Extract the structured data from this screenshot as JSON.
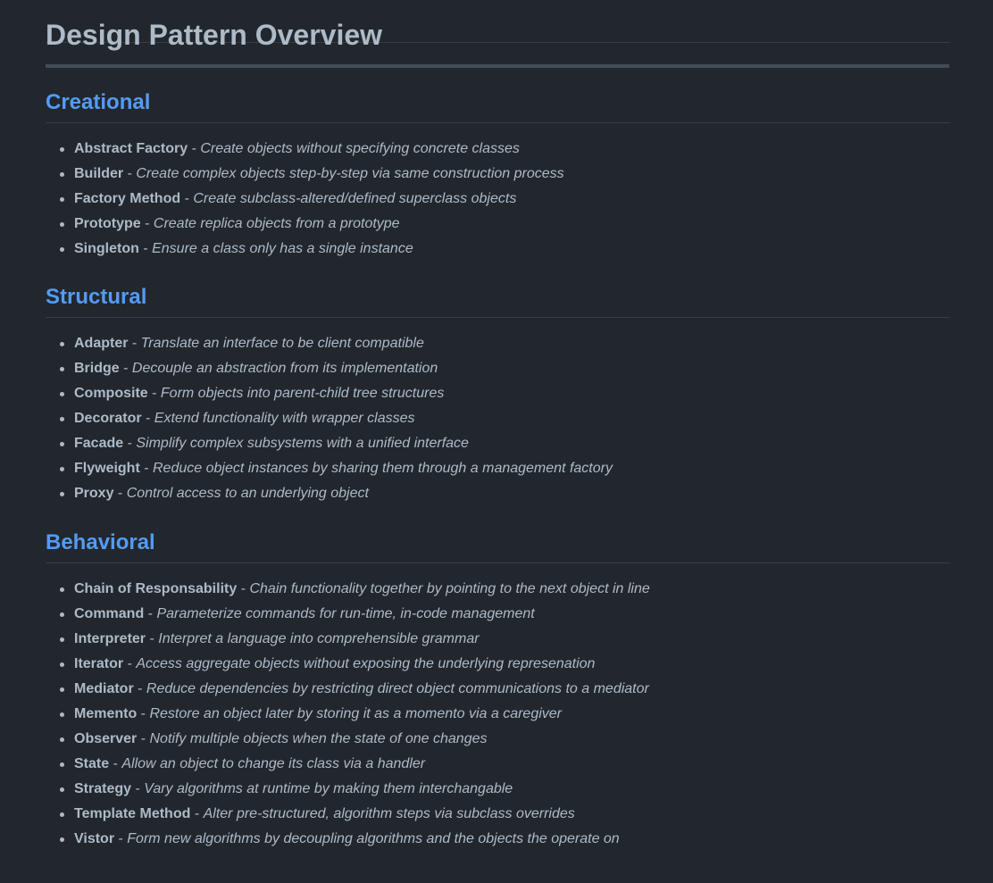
{
  "page": {
    "title": "Design Pattern Overview"
  },
  "colors": {
    "background": "#22272e",
    "text": "#adbac7",
    "heading_accent": "#539bf5",
    "divider": "#373e47"
  },
  "sections": [
    {
      "title": "Creational",
      "items": [
        {
          "name": "Abstract Factory",
          "sep": " - ",
          "desc": "Create objects without specifying concrete classes"
        },
        {
          "name": "Builder",
          "sep": " - ",
          "desc": "Create complex objects step-by-step via same construction process"
        },
        {
          "name": "Factory Method",
          "sep": " - ",
          "desc": "Create subclass-altered/defined superclass objects"
        },
        {
          "name": "Prototype",
          "sep": " - ",
          "desc": "Create replica objects from a prototype"
        },
        {
          "name": "Singleton",
          "sep": " - ",
          "desc": "Ensure a class only has a single instance"
        }
      ]
    },
    {
      "title": "Structural",
      "items": [
        {
          "name": "Adapter",
          "sep": " - ",
          "desc": "Translate an interface to be client compatible"
        },
        {
          "name": "Bridge",
          "sep": " - ",
          "desc": "Decouple an abstraction from its implementation"
        },
        {
          "name": "Composite",
          "sep": " - ",
          "desc": "Form objects into parent-child tree structures"
        },
        {
          "name": "Decorator",
          "sep": " - ",
          "desc": "Extend functionality with wrapper classes"
        },
        {
          "name": "Facade",
          "sep": " - ",
          "desc": "Simplify complex subsystems with a unified interface"
        },
        {
          "name": "Flyweight",
          "sep": " - ",
          "desc": "Reduce object instances by sharing them through a management factory"
        },
        {
          "name": "Proxy",
          "sep": " - ",
          "desc": "Control access to an underlying object"
        }
      ]
    },
    {
      "title": "Behavioral",
      "items": [
        {
          "name": "Chain of Responsability",
          "sep": " - ",
          "desc": "Chain functionality together by pointing to the next object in line"
        },
        {
          "name": "Command",
          "sep": " - ",
          "desc": "Parameterize commands for run-time, in-code management"
        },
        {
          "name": "Interpreter",
          "sep": " - ",
          "desc": "Interpret a language into comprehensible grammar"
        },
        {
          "name": "Iterator",
          "sep": " - ",
          "desc": "Access aggregate objects without exposing the underlying represenation"
        },
        {
          "name": "Mediator",
          "sep": " - ",
          "desc": "Reduce dependencies by restricting direct object communications to a mediator"
        },
        {
          "name": "Memento",
          "sep": " - ",
          "desc": "Restore an object later by storing it as a momento via a caregiver"
        },
        {
          "name": "Observer",
          "sep": " - ",
          "desc": "Notify multiple objects when the state of one changes"
        },
        {
          "name": "State",
          "sep": " - ",
          "desc": "Allow an object to change its class via a handler"
        },
        {
          "name": "Strategy",
          "sep": " - ",
          "desc": "Vary algorithms at runtime by making them interchangable"
        },
        {
          "name": "Template Method",
          "sep": " - ",
          "desc": "Alter pre-structured, algorithm steps via subclass overrides"
        },
        {
          "name": "Vistor",
          "sep": " - ",
          "desc": "Form new algorithms by decoupling algorithms and the objects the operate on"
        }
      ]
    }
  ]
}
